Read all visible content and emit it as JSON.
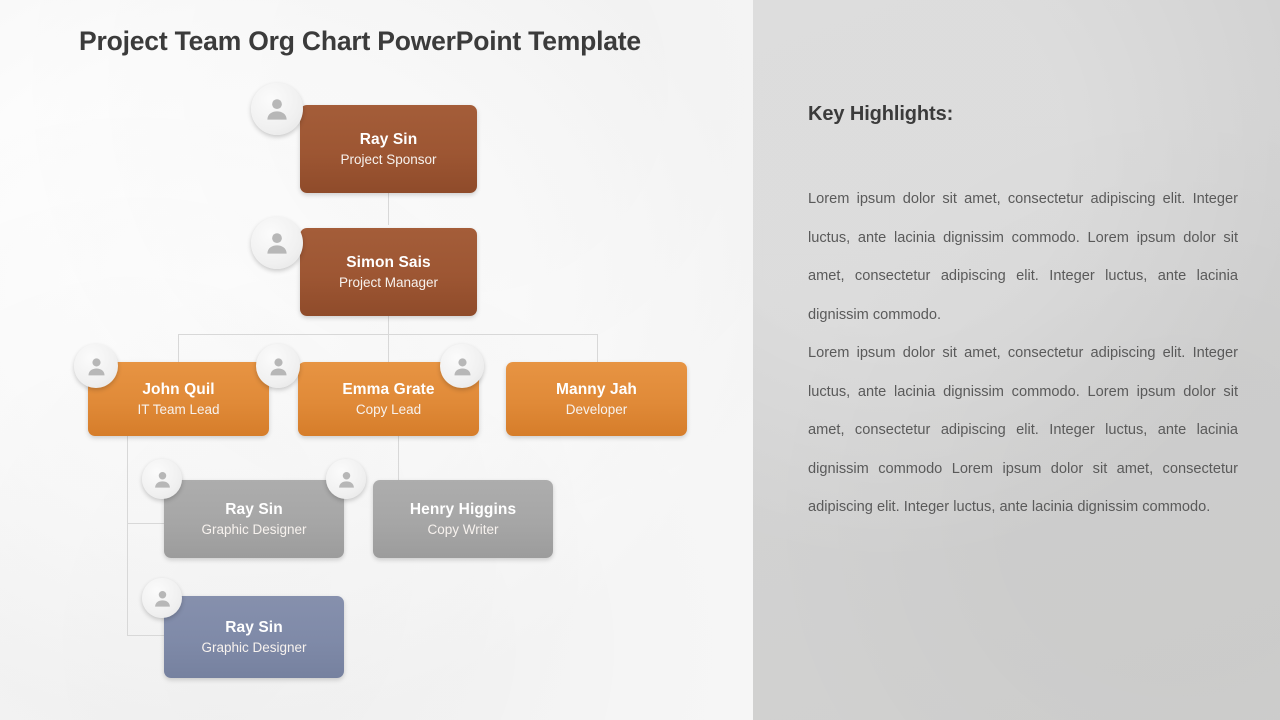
{
  "slide": {
    "title": "Project Team Org Chart PowerPoint Template",
    "canvas_bg": "#ffffff",
    "panel_bg": "#d2d2d2"
  },
  "colors": {
    "brown": "#9d5633",
    "brown_dark": "#8d4a2b",
    "orange": "#e08a38",
    "orange_dark": "#d97f2c",
    "gray": "#a6a6a6",
    "blue_gray": "#7f8aa8",
    "connector": "#d8d8d8",
    "title_text": "#3b3b3b",
    "body_text": "#5a5a5a",
    "avatar_circle": "#eeeeee",
    "avatar_glyph": "#b7b7b7"
  },
  "org_chart": {
    "nodes": [
      {
        "id": "sponsor",
        "name": "Ray Sin",
        "role": "Project Sponsor",
        "color": "brown",
        "icon": "person-avatar-icon"
      },
      {
        "id": "manager",
        "name": "Simon Sais",
        "role": "Project Manager",
        "color": "brown",
        "icon": "person-avatar-icon"
      },
      {
        "id": "it-lead",
        "name": "John Quil",
        "role": "IT Team Lead",
        "color": "orange",
        "icon": "person-avatar-icon"
      },
      {
        "id": "copy-lead",
        "name": "Emma Grate",
        "role": "Copy Lead",
        "color": "orange",
        "icon": "person-avatar-icon"
      },
      {
        "id": "developer",
        "name": "Manny Jah",
        "role": "Developer",
        "color": "orange",
        "icon": "person-avatar-icon"
      },
      {
        "id": "designer1",
        "name": "Ray Sin",
        "role": "Graphic Designer",
        "color": "gray",
        "icon": "person-avatar-icon"
      },
      {
        "id": "writer",
        "name": "Henry Higgins",
        "role": "Copy Writer",
        "color": "gray",
        "icon": "person-avatar-icon"
      },
      {
        "id": "designer2",
        "name": "Ray Sin",
        "role": "Graphic Designer",
        "color": "blue_gray",
        "icon": "person-avatar-icon"
      }
    ]
  },
  "highlights": {
    "title": "Key Highlights:",
    "paragraphs": [
      "Lorem ipsum dolor sit amet, consectetur adipiscing elit. Integer luctus, ante lacinia dignissim commodo. Lorem ipsum dolor sit amet, consectetur adipiscing elit. Integer luctus, ante lacinia dignissim commodo.",
      "Lorem ipsum dolor sit amet, consectetur adipiscing elit. Integer luctus, ante lacinia dignissim commodo. Lorem ipsum dolor sit amet, consectetur adipiscing elit. Integer luctus, ante lacinia dignissim commodo Lorem ipsum dolor sit amet, consectetur adipiscing elit. Integer luctus, ante lacinia dignissim commodo."
    ]
  }
}
